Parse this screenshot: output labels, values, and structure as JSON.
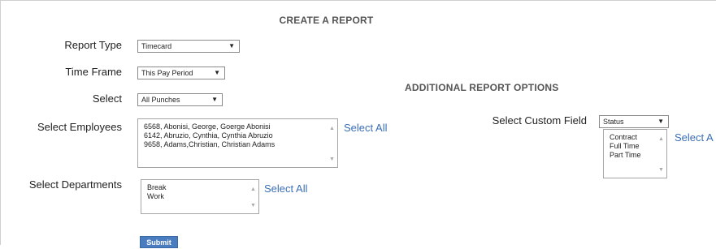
{
  "page": {
    "title": "CREATE A REPORT",
    "additional_heading": "ADDITIONAL REPORT OPTIONS"
  },
  "report_type": {
    "label": "Report Type",
    "value": "Timecard",
    "arrow_icon": "triangle-down"
  },
  "time_frame": {
    "label": "Time Frame",
    "value": "This Pay Period",
    "arrow_icon": "triangle-down"
  },
  "select_punches": {
    "label": "Select",
    "value": "All Punches",
    "arrow_icon": "triangle-down"
  },
  "employees": {
    "label": "Select Employees",
    "options": [
      "6568,  Abonisi, George,  Goerge Abonisi",
      "6142,  Abruzio, Cynthia,  Cynthia Abruzio",
      "9658,  Adams,Christian,  Christian Adams"
    ],
    "select_all": "Select All"
  },
  "departments": {
    "label": "Select Departments",
    "options": [
      "Break",
      "Work"
    ],
    "select_all": "Select All"
  },
  "custom_field": {
    "label": "Select Custom Field",
    "value": "Status",
    "arrow_icon": "triangle-down",
    "options": [
      "Contract",
      "Full Time",
      "Part Time"
    ],
    "select_all": "Select A"
  },
  "submit": {
    "label": "Submit"
  },
  "colors": {
    "link": "#3b6fb6",
    "button": "#4a7cc0"
  }
}
